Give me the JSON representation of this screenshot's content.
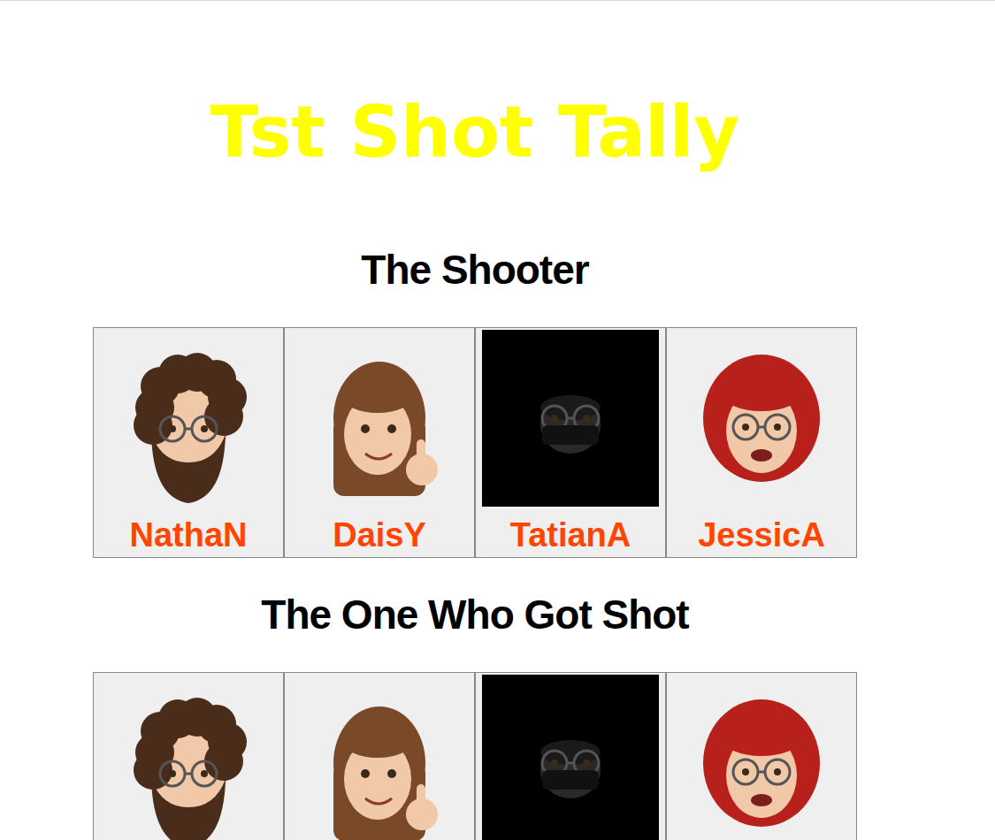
{
  "page": {
    "title": "Tst Shot Tally"
  },
  "sections": [
    {
      "heading": "The Shooter",
      "players": [
        {
          "name": "NathaN",
          "kind": "curly-beard",
          "color": "#4a2c1a"
        },
        {
          "name": "DaisY",
          "kind": "long-hair",
          "color": "#7a4a28"
        },
        {
          "name": "TatianA",
          "kind": "masked",
          "color": "#2a2a2a"
        },
        {
          "name": "JessicA",
          "kind": "red-hair",
          "color": "#b8201c"
        }
      ]
    },
    {
      "heading": "The One Who Got Shot",
      "players": [
        {
          "kind": "curly-beard",
          "color": "#4a2c1a"
        },
        {
          "kind": "long-hair",
          "color": "#7a4a28"
        },
        {
          "kind": "masked",
          "color": "#2a2a2a"
        },
        {
          "kind": "red-hair",
          "color": "#b8201c"
        }
      ]
    }
  ]
}
